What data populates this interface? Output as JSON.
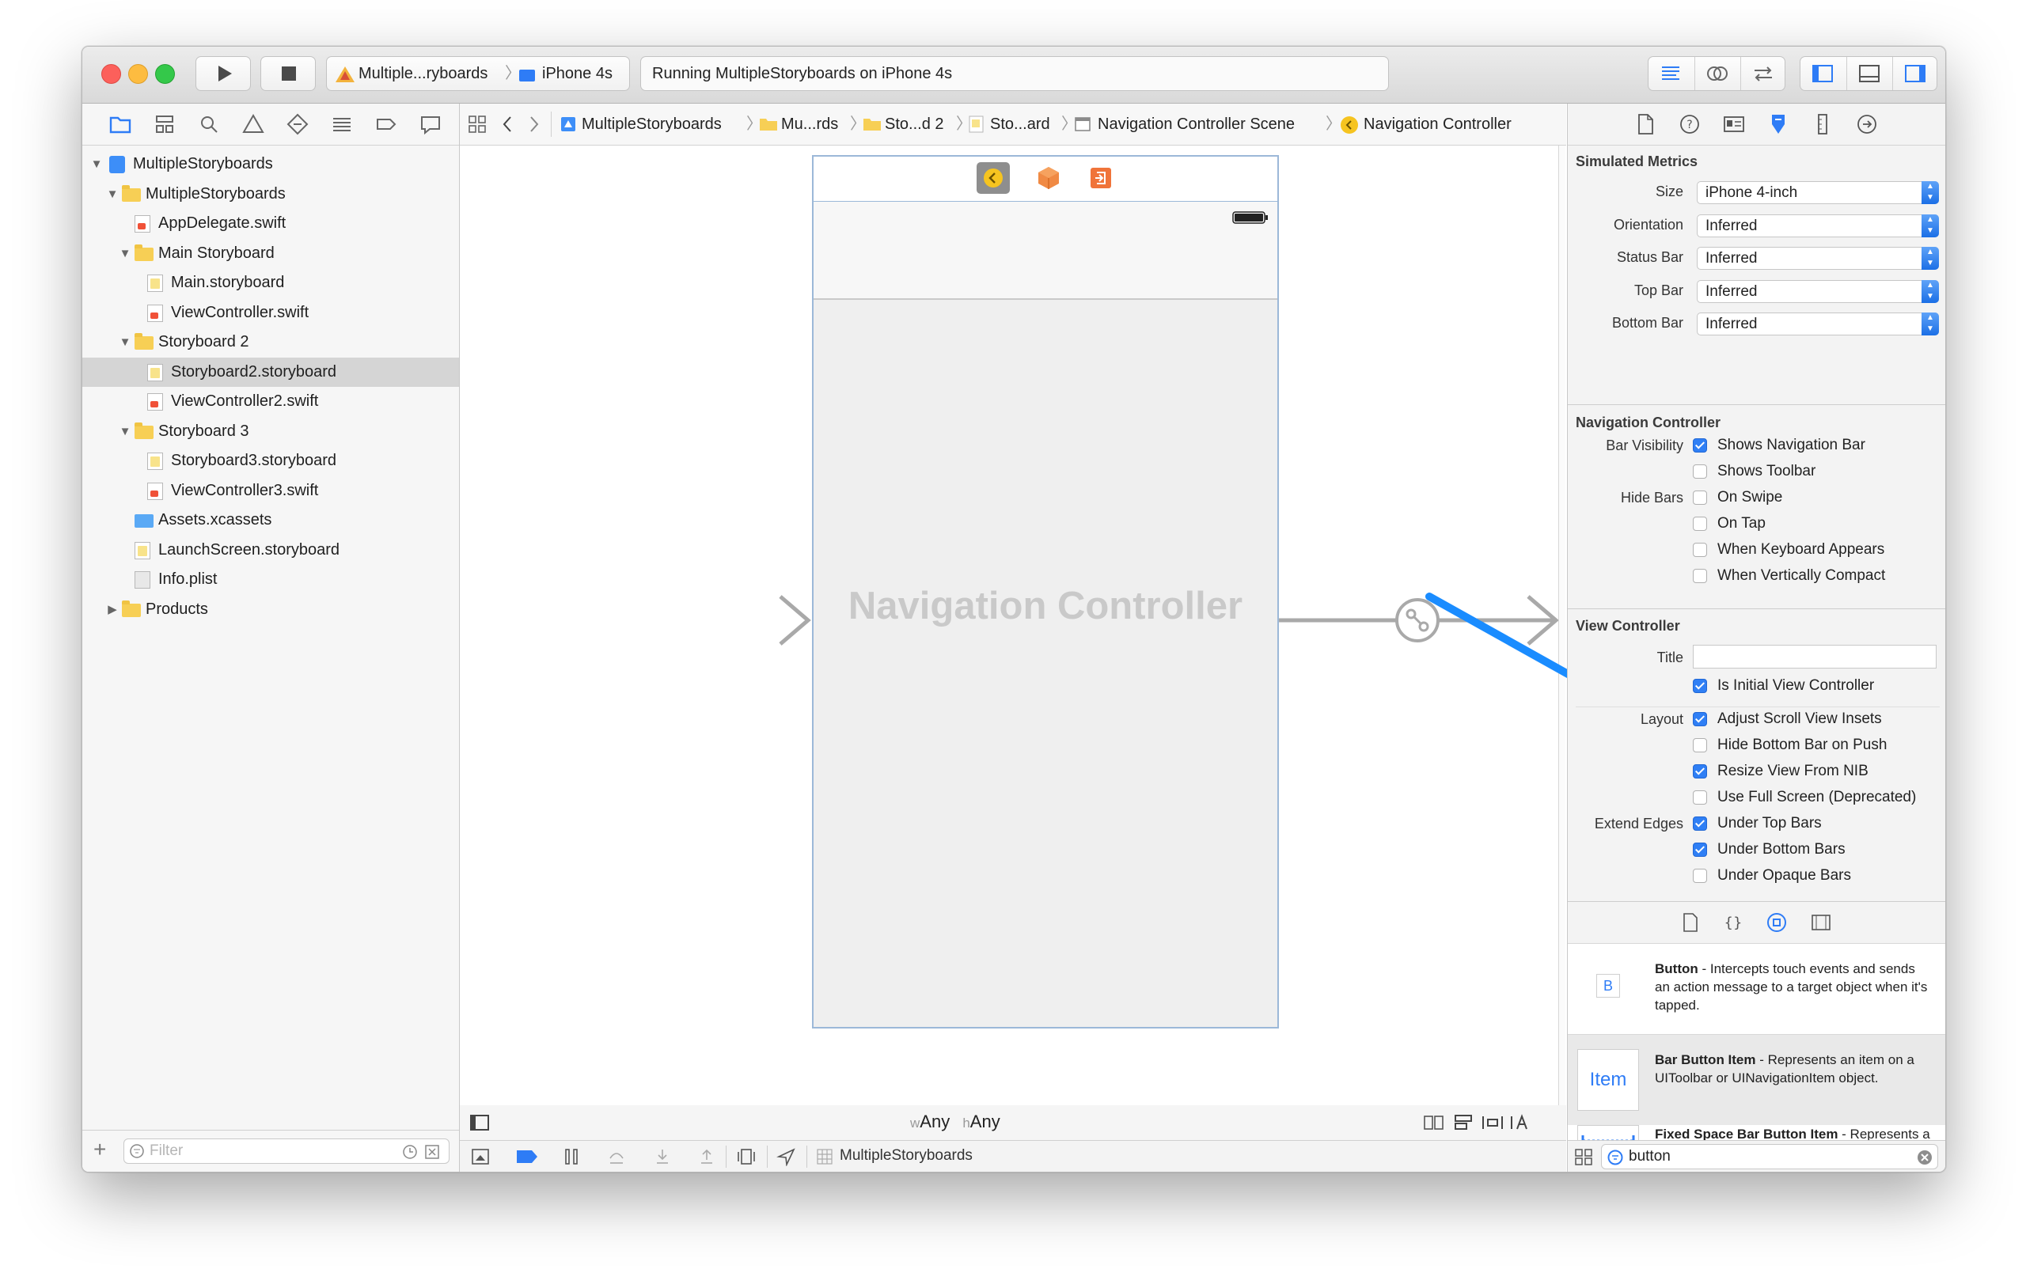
{
  "toolbar": {
    "scheme_app": "Multiple...ryboards",
    "scheme_device": "iPhone 4s",
    "activity_status": "Running MultipleStoryboards on iPhone 4s"
  },
  "jumpbar": {
    "items": [
      "MultipleStoryboards",
      "Mu...rds",
      "Sto...d 2",
      "Sto...ard",
      "Navigation Controller Scene",
      "Navigation Controller"
    ]
  },
  "navigator": {
    "items": [
      {
        "label": "MultipleStoryboards",
        "kind": "project"
      },
      {
        "label": "MultipleStoryboards",
        "kind": "folder"
      },
      {
        "label": "AppDelegate.swift",
        "kind": "swift"
      },
      {
        "label": "Main Storyboard",
        "kind": "folder"
      },
      {
        "label": "Main.storyboard",
        "kind": "storyboard"
      },
      {
        "label": "ViewController.swift",
        "kind": "swift"
      },
      {
        "label": "Storyboard 2",
        "kind": "folder"
      },
      {
        "label": "Storyboard2.storyboard",
        "kind": "storyboard",
        "selected": true
      },
      {
        "label": "ViewController2.swift",
        "kind": "swift"
      },
      {
        "label": "Storyboard 3",
        "kind": "folder"
      },
      {
        "label": "Storyboard3.storyboard",
        "kind": "storyboard"
      },
      {
        "label": "ViewController3.swift",
        "kind": "swift"
      },
      {
        "label": "Assets.xcassets",
        "kind": "assets"
      },
      {
        "label": "LaunchScreen.storyboard",
        "kind": "storyboard"
      },
      {
        "label": "Info.plist",
        "kind": "plist"
      },
      {
        "label": "Products",
        "kind": "folder"
      }
    ],
    "filter_placeholder": "Filter"
  },
  "canvas": {
    "scene_title": "Navigation Controller",
    "size_class_w": "w",
    "size_class_w_value": "Any",
    "size_class_h": "h",
    "size_class_h_value": "Any"
  },
  "debugbar": {
    "target": "MultipleStoryboards"
  },
  "inspector": {
    "simulated_metrics": {
      "heading": "Simulated Metrics",
      "rows": [
        {
          "label": "Size",
          "value": "iPhone 4-inch"
        },
        {
          "label": "Orientation",
          "value": "Inferred"
        },
        {
          "label": "Status Bar",
          "value": "Inferred"
        },
        {
          "label": "Top Bar",
          "value": "Inferred"
        },
        {
          "label": "Bottom Bar",
          "value": "Inferred"
        }
      ]
    },
    "navigation_controller": {
      "heading": "Navigation Controller",
      "bar_visibility_label": "Bar Visibility",
      "hide_bars_label": "Hide Bars",
      "shows_navigation_bar": "Shows Navigation Bar",
      "shows_toolbar": "Shows Toolbar",
      "on_swipe": "On Swipe",
      "on_tap": "On Tap",
      "when_keyboard_appears": "When Keyboard Appears",
      "when_vertically_compact": "When Vertically Compact"
    },
    "view_controller": {
      "heading": "View Controller",
      "title_label": "Title",
      "title_value": "",
      "is_initial": "Is Initial View Controller",
      "layout_label": "Layout",
      "adjust_scroll": "Adjust Scroll View Insets",
      "hide_bottom_bar": "Hide Bottom Bar on Push",
      "resize_from_nib": "Resize View From NIB",
      "use_full_screen": "Use Full Screen (Deprecated)",
      "extend_edges_label": "Extend Edges",
      "under_top_bars": "Under Top Bars",
      "under_bottom_bars": "Under Bottom Bars",
      "under_opaque_bars": "Under Opaque Bars"
    },
    "library": {
      "items": [
        {
          "icon_text": "B",
          "title": "Button",
          "desc": " - Intercepts touch events and sends an action message to a target object when it's tapped."
        },
        {
          "icon_text": "Item",
          "title": "Bar Button Item",
          "desc": " - Represents an item on a UIToolbar or UINavigationItem object."
        },
        {
          "icon_text": "",
          "title": "Fixed Space Bar Button Item",
          "desc": " - Represents a fixed space item on a"
        }
      ],
      "search_value": "button"
    }
  },
  "colors": {
    "accent": "#2e7cf6",
    "annotation_arrow": "#1a8cff",
    "close": "#fc605b",
    "minimize": "#fdbc40",
    "zoom": "#34c84a"
  }
}
